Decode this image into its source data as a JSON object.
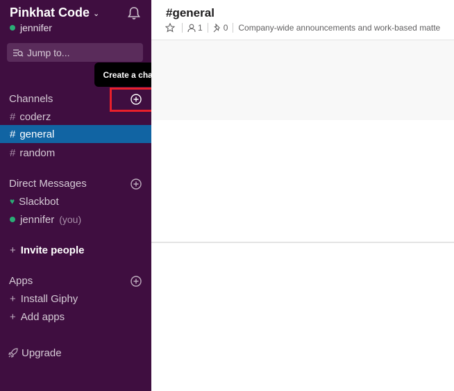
{
  "sidebar": {
    "team_name": "Pinkhat Code",
    "user_name": "jennifer",
    "jump_placeholder": "Jump to...",
    "channels_heading": "Channels",
    "channels": [
      {
        "label": "coderz"
      },
      {
        "label": "general"
      },
      {
        "label": "random"
      }
    ],
    "dm_heading": "Direct Messages",
    "dms": [
      {
        "label": "Slackbot"
      },
      {
        "label": "jennifer",
        "suffix": "(you)"
      }
    ],
    "invite_label": "Invite people",
    "apps_heading": "Apps",
    "apps": [
      {
        "label": "Install Giphy"
      },
      {
        "label": "Add apps"
      }
    ],
    "upgrade_label": "Upgrade"
  },
  "tooltip": {
    "text": "Create a channel"
  },
  "header": {
    "channel_title": "#general",
    "member_count": "1",
    "pinned_count": "0",
    "topic": "Company-wide announcements and work-based matte"
  },
  "colors": {
    "sidebar_bg": "#3f0e40",
    "active_item": "#1164a3",
    "presence_green": "#2bac76",
    "highlight_red": "#e8202a"
  }
}
